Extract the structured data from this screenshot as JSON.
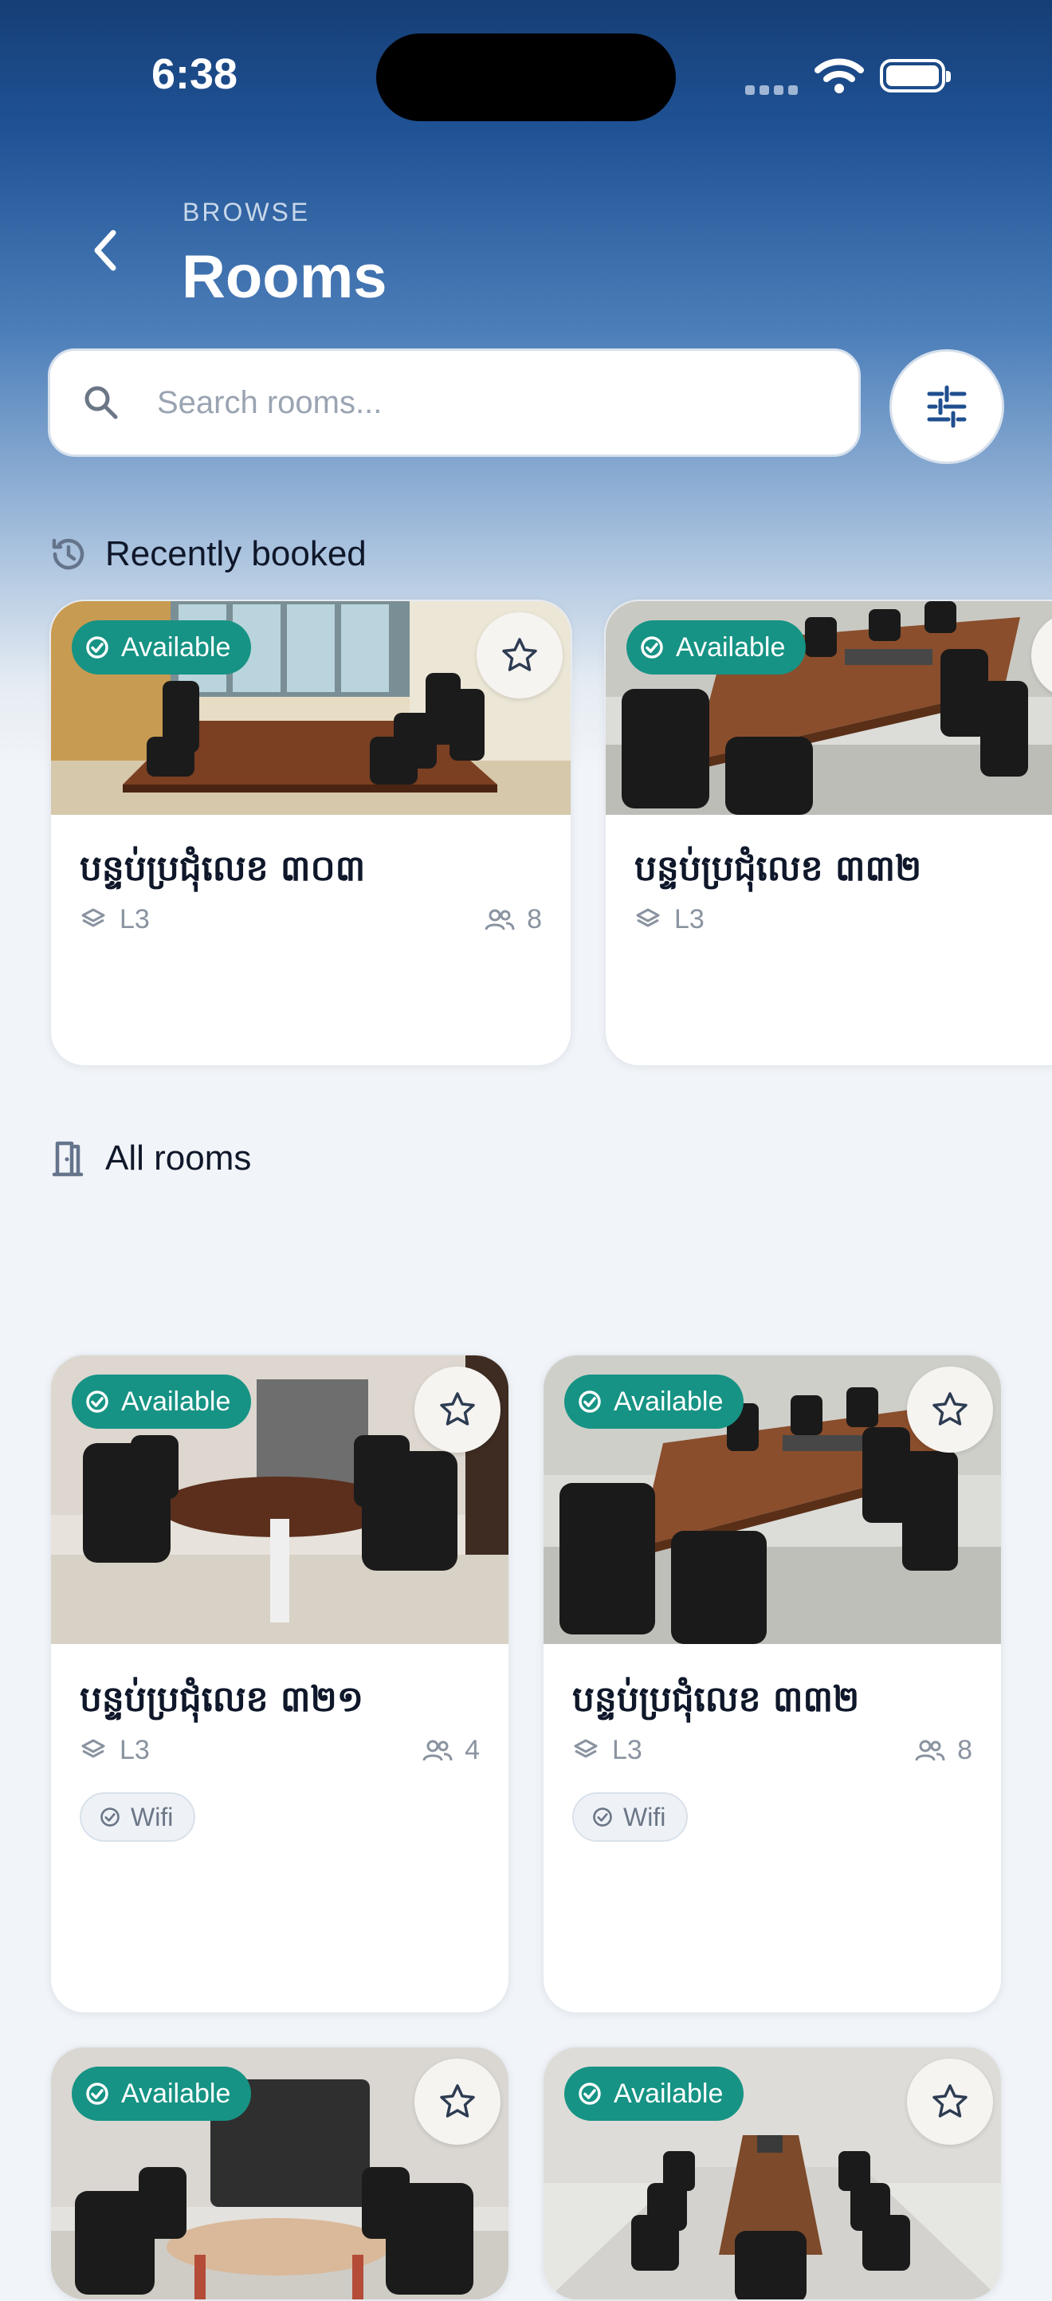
{
  "status_bar": {
    "time": "6:38"
  },
  "header": {
    "eyebrow": "BROWSE",
    "title": "Rooms"
  },
  "search": {
    "placeholder": "Search rooms..."
  },
  "sections": {
    "recent": "Recently booked",
    "all": "All rooms"
  },
  "colors": {
    "accent": "#169384",
    "brand": "#1f5294",
    "background": "#f1f4f8"
  },
  "recent_rooms": [
    {
      "status": "Available",
      "name": "បន្ទប់ប្រជុំលេខ ៣០៣",
      "floor": "L3",
      "capacity": "8"
    },
    {
      "status": "Available",
      "name": "បន្ទប់ប្រជុំលេខ ៣៣២",
      "floor": "L3",
      "capacity": ""
    }
  ],
  "all_rooms": [
    {
      "status": "Available",
      "name": "បន្ទប់ប្រជុំលេខ ៣២១",
      "floor": "L3",
      "capacity": "4",
      "amenity": "Wifi"
    },
    {
      "status": "Available",
      "name": "បន្ទប់ប្រជុំលេខ ៣៣២",
      "floor": "L3",
      "capacity": "8",
      "amenity": "Wifi"
    },
    {
      "status": "Available"
    },
    {
      "status": "Available"
    }
  ],
  "icons": {
    "back": "chevron-left-icon",
    "search": "search-icon",
    "filter": "sliders-icon",
    "recent": "history-icon",
    "all": "door-icon",
    "status": "check-circle-icon",
    "favorite": "star-icon",
    "floor": "layers-icon",
    "capacity": "users-icon"
  }
}
